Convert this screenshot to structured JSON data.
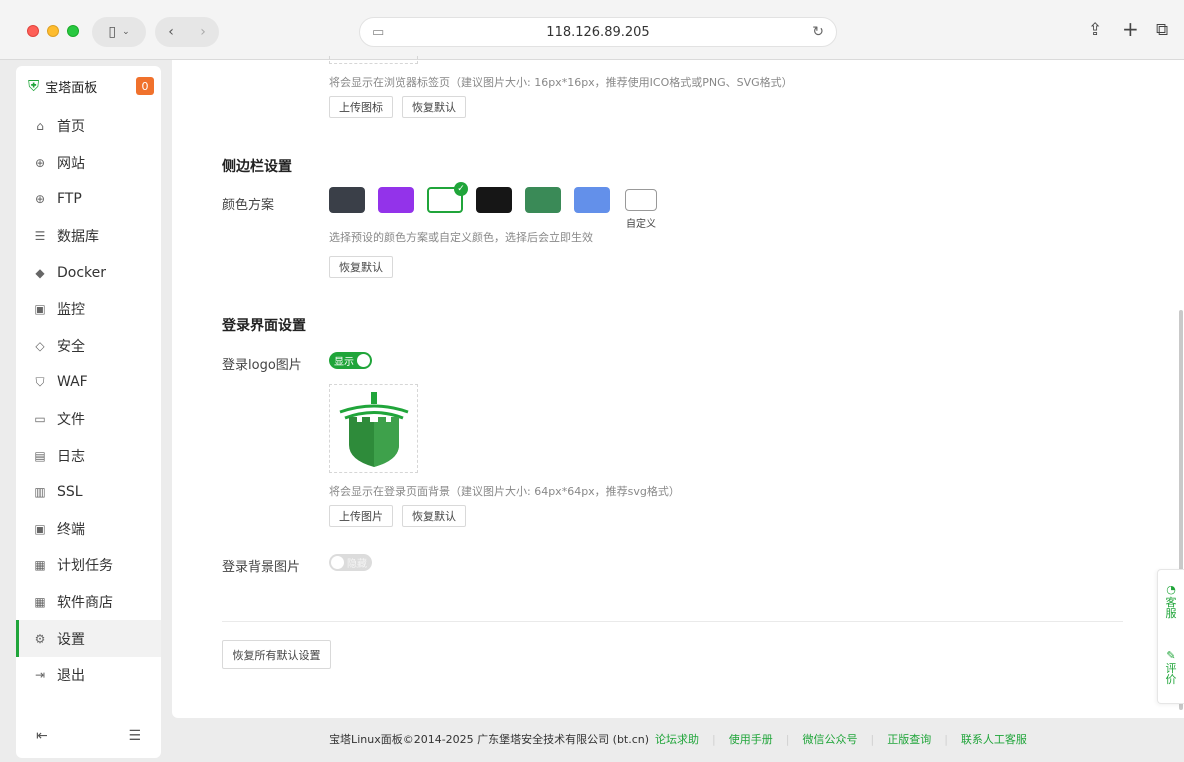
{
  "browser": {
    "url": "118.126.89.205"
  },
  "sidebar": {
    "brand": "宝塔面板",
    "badge": "0",
    "items": [
      {
        "label": "首页",
        "icon": "home-icon",
        "glyph": "⌂"
      },
      {
        "label": "网站",
        "icon": "globe-icon",
        "glyph": "⊕"
      },
      {
        "label": "FTP",
        "icon": "ftp-icon",
        "glyph": "⊕"
      },
      {
        "label": "数据库",
        "icon": "database-icon",
        "glyph": "☰"
      },
      {
        "label": "Docker",
        "icon": "docker-icon",
        "glyph": "◆"
      },
      {
        "label": "监控",
        "icon": "monitor-icon",
        "glyph": "▣"
      },
      {
        "label": "安全",
        "icon": "shield-icon",
        "glyph": "◇"
      },
      {
        "label": "WAF",
        "icon": "waf-icon",
        "glyph": "⛉"
      },
      {
        "label": "文件",
        "icon": "folder-icon",
        "glyph": "▭"
      },
      {
        "label": "日志",
        "icon": "log-icon",
        "glyph": "▤"
      },
      {
        "label": "SSL",
        "icon": "ssl-icon",
        "glyph": "▥"
      },
      {
        "label": "终端",
        "icon": "terminal-icon",
        "glyph": "▣"
      },
      {
        "label": "计划任务",
        "icon": "calendar-icon",
        "glyph": "▦"
      },
      {
        "label": "软件商店",
        "icon": "apps-icon",
        "glyph": "▦"
      },
      {
        "label": "设置",
        "icon": "gear-icon",
        "glyph": "⚙"
      },
      {
        "label": "退出",
        "icon": "logout-icon",
        "glyph": "⇥"
      }
    ],
    "active_index": 14
  },
  "favicon_section": {
    "hint": "将会显示在浏览器标签页（建议图片大小: 16px*16px，推荐使用ICO格式或PNG、SVG格式）",
    "upload_label": "上传图标",
    "reset_label": "恢复默认"
  },
  "sidebar_settings": {
    "title": "侧边栏设置",
    "color_label": "颜色方案",
    "swatches": [
      "#3a3f48",
      "#9333ea",
      "#ffffff",
      "#161616",
      "#3a8a57",
      "#6390ea"
    ],
    "selected_swatch": 2,
    "custom_label": "自定义",
    "hint": "选择预设的颜色方案或自定义颜色，选择后会立即生效",
    "reset_label": "恢复默认"
  },
  "login_settings": {
    "title": "登录界面设置",
    "logo_label": "登录logo图片",
    "logo_toggle_text": "显示",
    "logo_hint": "将会显示在登录页面背景（建议图片大小: 64px*64px，推荐svg格式）",
    "upload_label": "上传图片",
    "reset_label": "恢复默认",
    "bg_label": "登录背景图片",
    "bg_toggle_text": "隐藏"
  },
  "reset_all_label": "恢复所有默认设置",
  "footer": {
    "copyright": "宝塔Linux面板©2014-2025 广东堡塔安全技术有限公司 (bt.cn)",
    "links": [
      "论坛求助",
      "使用手册",
      "微信公众号",
      "正版查询",
      "联系人工客服"
    ]
  },
  "float_service": {
    "service_label": "客服",
    "review_label": "评价"
  },
  "colors": {
    "brand_green": "#20a53a",
    "badge_orange": "#f0712c"
  }
}
